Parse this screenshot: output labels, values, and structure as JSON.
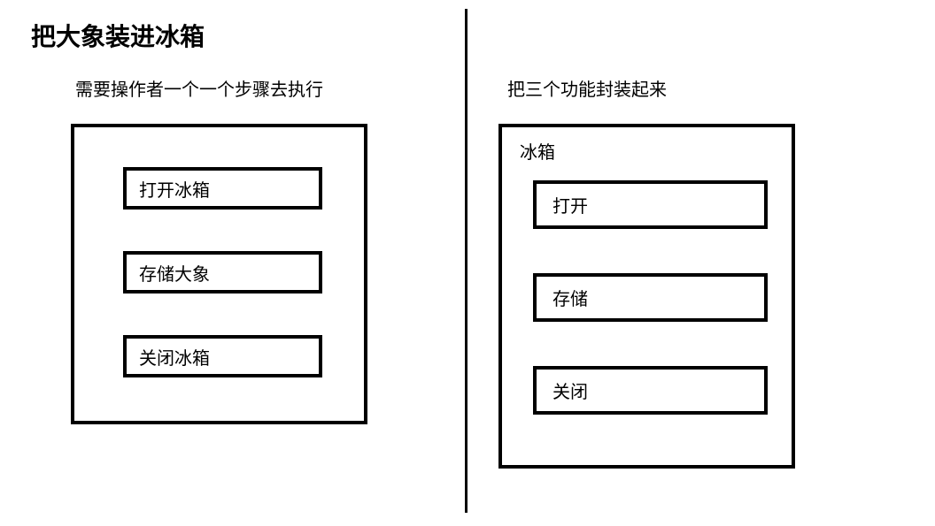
{
  "title": "把大象装进冰箱",
  "left": {
    "subtitle": "需要操作者一个一个步骤去执行",
    "steps": [
      "打开冰箱",
      "存储大象",
      "关闭冰箱"
    ]
  },
  "right": {
    "subtitle": "把三个功能封装起来",
    "boxLabel": "冰箱",
    "steps": [
      "打开",
      "存储",
      "关闭"
    ]
  }
}
